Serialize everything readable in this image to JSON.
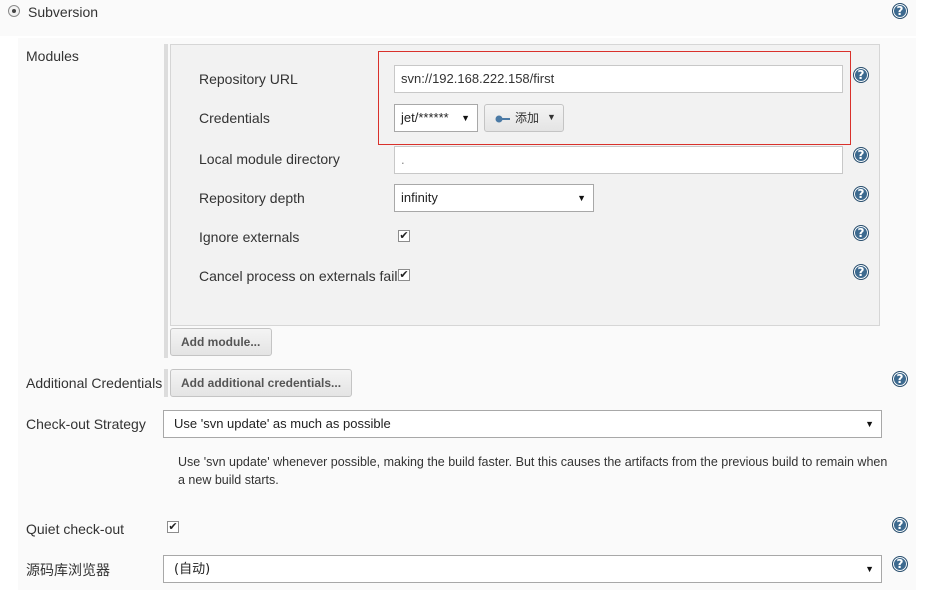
{
  "scm": {
    "option_label": "Subversion"
  },
  "modules": {
    "label": "Modules",
    "repository_url_label": "Repository URL",
    "repository_url_value": "svn://192.168.222.158/first",
    "credentials_label": "Credentials",
    "credentials_value": "jet/******",
    "add_button_label": "添加",
    "local_module_dir_label": "Local module directory",
    "local_module_dir_value": ".",
    "repository_depth_label": "Repository depth",
    "repository_depth_value": "infinity",
    "ignore_externals_label": "Ignore externals",
    "ignore_externals_checked": true,
    "cancel_externals_label": "Cancel process on externals fail",
    "cancel_externals_checked": true,
    "add_module_button": "Add module..."
  },
  "additional_credentials": {
    "label": "Additional Credentials",
    "button": "Add additional credentials..."
  },
  "checkout_strategy": {
    "label": "Check-out Strategy",
    "value": "Use 'svn update' as much as possible",
    "description": "Use 'svn update' whenever possible, making the build faster. But this causes the artifacts from the previous build to remain when a new build starts."
  },
  "quiet_checkout": {
    "label": "Quiet check-out",
    "checked": true
  },
  "repository_browser": {
    "label": "源码库浏览器",
    "value": "(自动)"
  },
  "icons": {
    "help": "?",
    "check": "✔",
    "caret": "▼",
    "key": "key-icon"
  },
  "colors": {
    "highlight_border": "#d9312b",
    "help_icon": "#3d6a8f",
    "button_bg": "#e8e8e8"
  }
}
